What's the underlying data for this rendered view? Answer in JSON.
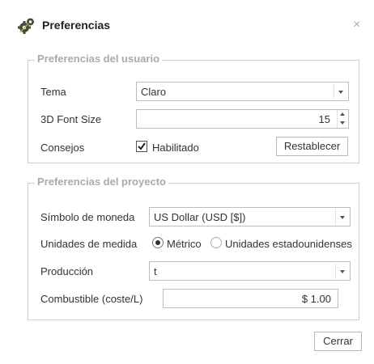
{
  "dialog": {
    "title": "Preferencias",
    "icon": "gears-icon",
    "close_label": "×"
  },
  "user_prefs": {
    "legend": "Preferencias del usuario",
    "theme": {
      "label": "Tema",
      "value": "Claro"
    },
    "font_size": {
      "label": "3D Font Size",
      "value": "15"
    },
    "tips": {
      "label": "Consejos",
      "checkbox_label": "Habilitado",
      "checked": true,
      "reset_label": "Restablecer"
    }
  },
  "project_prefs": {
    "legend": "Preferencias del proyecto",
    "currency": {
      "label": "Símbolo de moneda",
      "value": "US Dollar (USD [$])"
    },
    "units": {
      "label": "Unidades de medida",
      "option_metric": "Métrico",
      "option_us": "Unidades estadounidenses",
      "selected": "metric"
    },
    "production": {
      "label": "Producción",
      "value": "t"
    },
    "fuel": {
      "label": "Combustible (coste/L)",
      "value": "$ 1.00"
    }
  },
  "footer": {
    "close_label": "Cerrar"
  }
}
